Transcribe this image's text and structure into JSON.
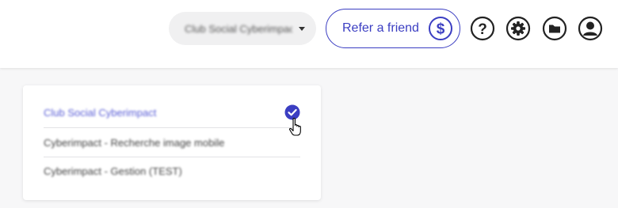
{
  "header": {
    "account_select": {
      "value": "Club Social Cyberimpact"
    },
    "refer_button": {
      "label": "Refer a friend",
      "icon": "dollar-circle-icon"
    },
    "icons": [
      "help-icon",
      "gear-icon",
      "folder-icon",
      "user-icon"
    ]
  },
  "dropdown": {
    "options": [
      {
        "label": "Club Social Cyberimpact",
        "selected": true
      },
      {
        "label": "Cyberimpact - Recherche image mobile",
        "selected": false
      },
      {
        "label": "Cyberimpact - Gestion (TEST)",
        "selected": false
      }
    ]
  },
  "colors": {
    "accent": "#3b3ec2",
    "selected_text": "#5a5ed6",
    "background": "#f7f7f8"
  }
}
